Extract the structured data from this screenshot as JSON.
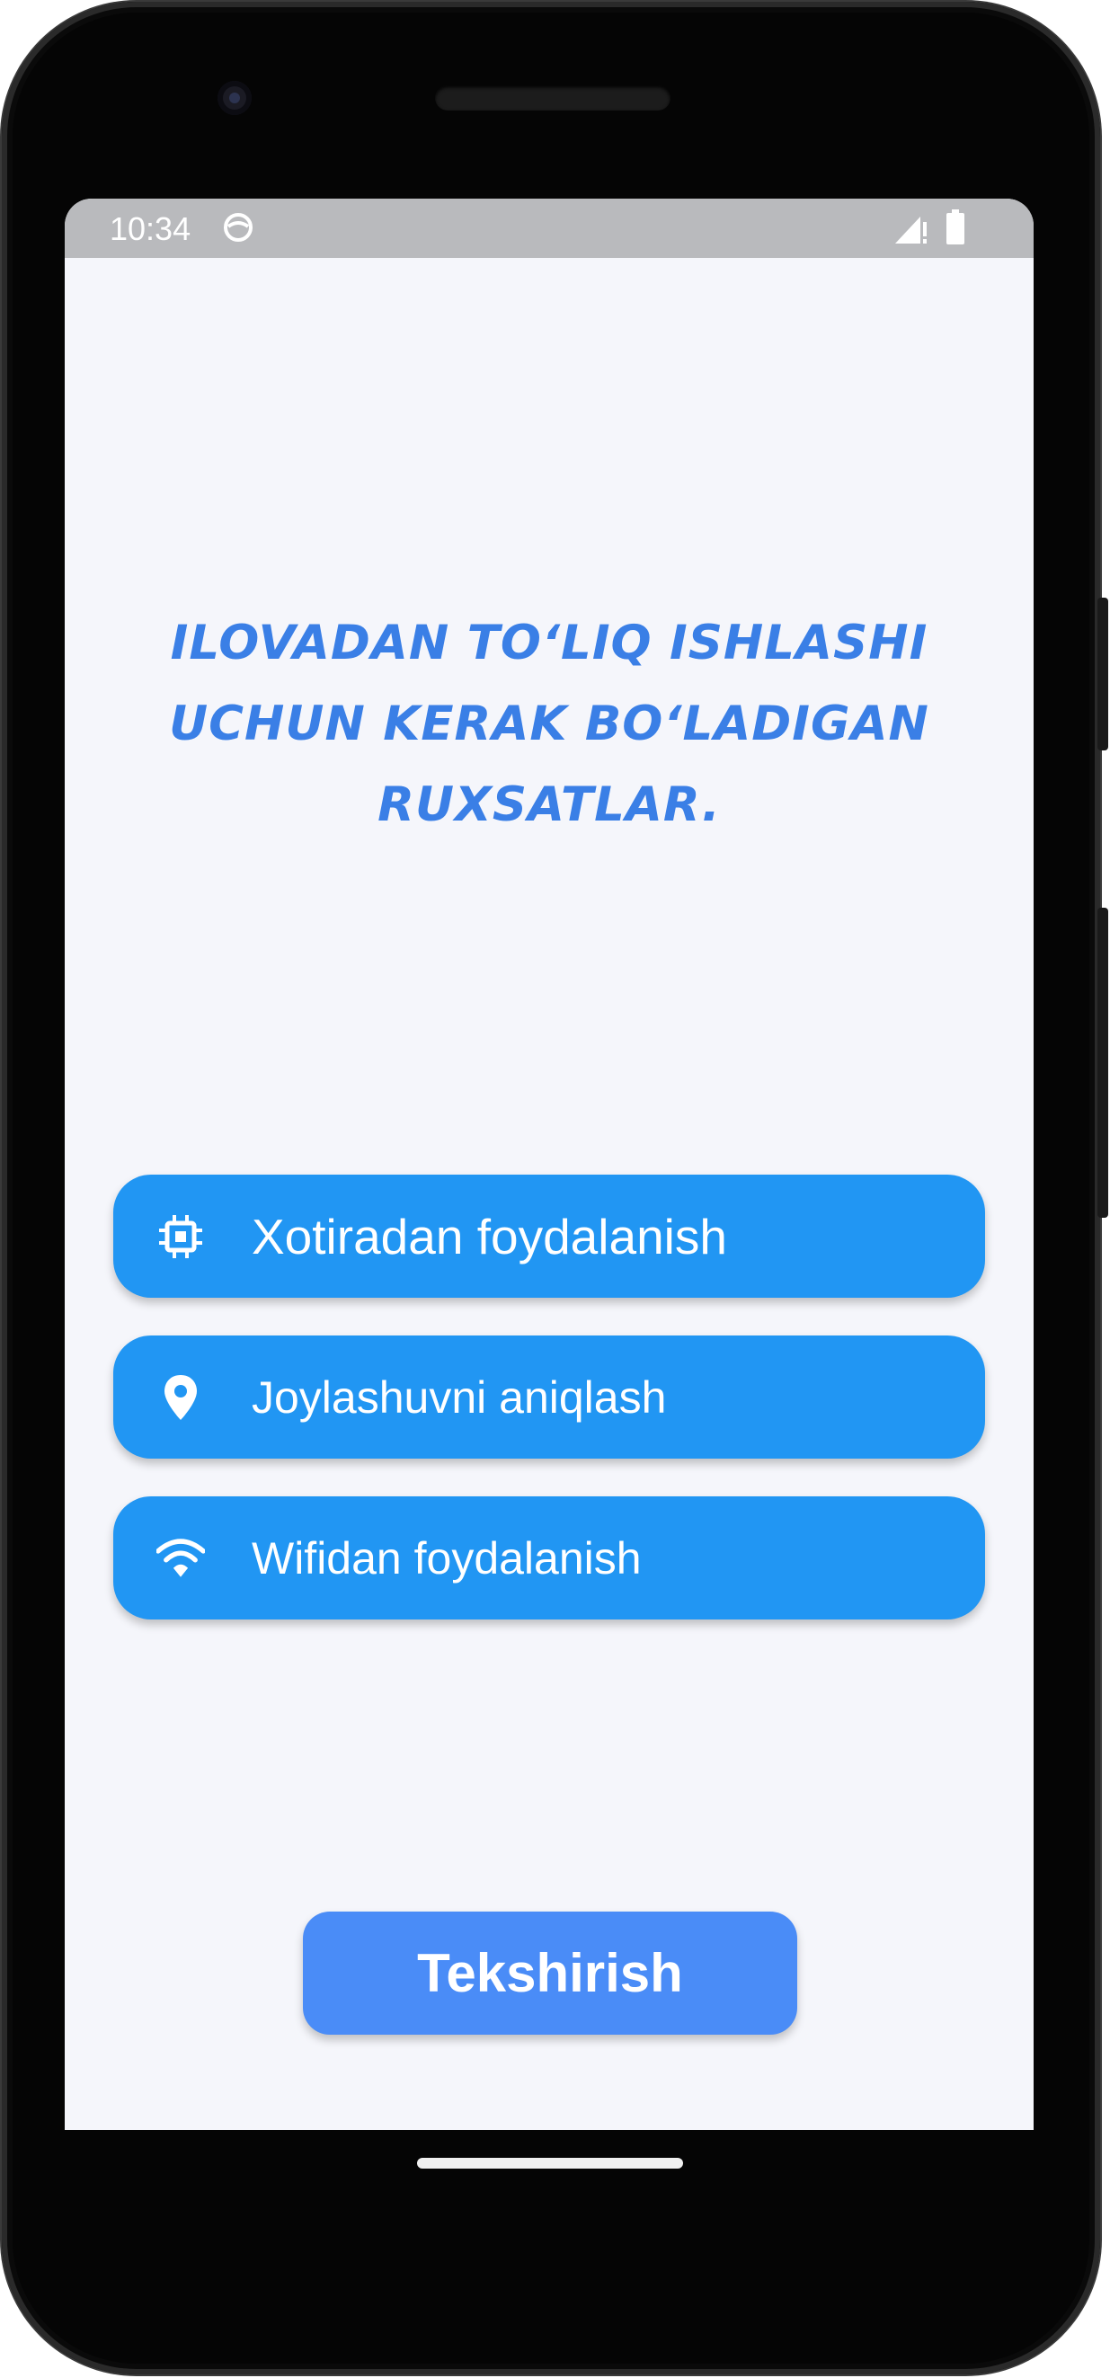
{
  "status_bar": {
    "time": "10:34",
    "app_icon": "android-face-icon",
    "signal_icon": "signal-no-data-icon",
    "battery_icon": "battery-full-icon"
  },
  "heading": {
    "text": "Ilovadan to‘liq ishlashi uchun kerak bo‘ladigan ruxsatlar.",
    "color": "#3a7fe6"
  },
  "permissions": [
    {
      "icon": "memory-chip-icon",
      "label": "Xotiradan foydalanish"
    },
    {
      "icon": "location-pin-icon",
      "label": "Joylashuvni aniqlash"
    },
    {
      "icon": "wifi-icon",
      "label": "Wifidan foydalanish"
    }
  ],
  "check_button": {
    "label": "Tekshirish"
  },
  "colors": {
    "permission_button": "#2196f3",
    "check_button": "#4a8cf7",
    "screen_background": "#f5f6fb",
    "status_bar": "#b9babd"
  }
}
